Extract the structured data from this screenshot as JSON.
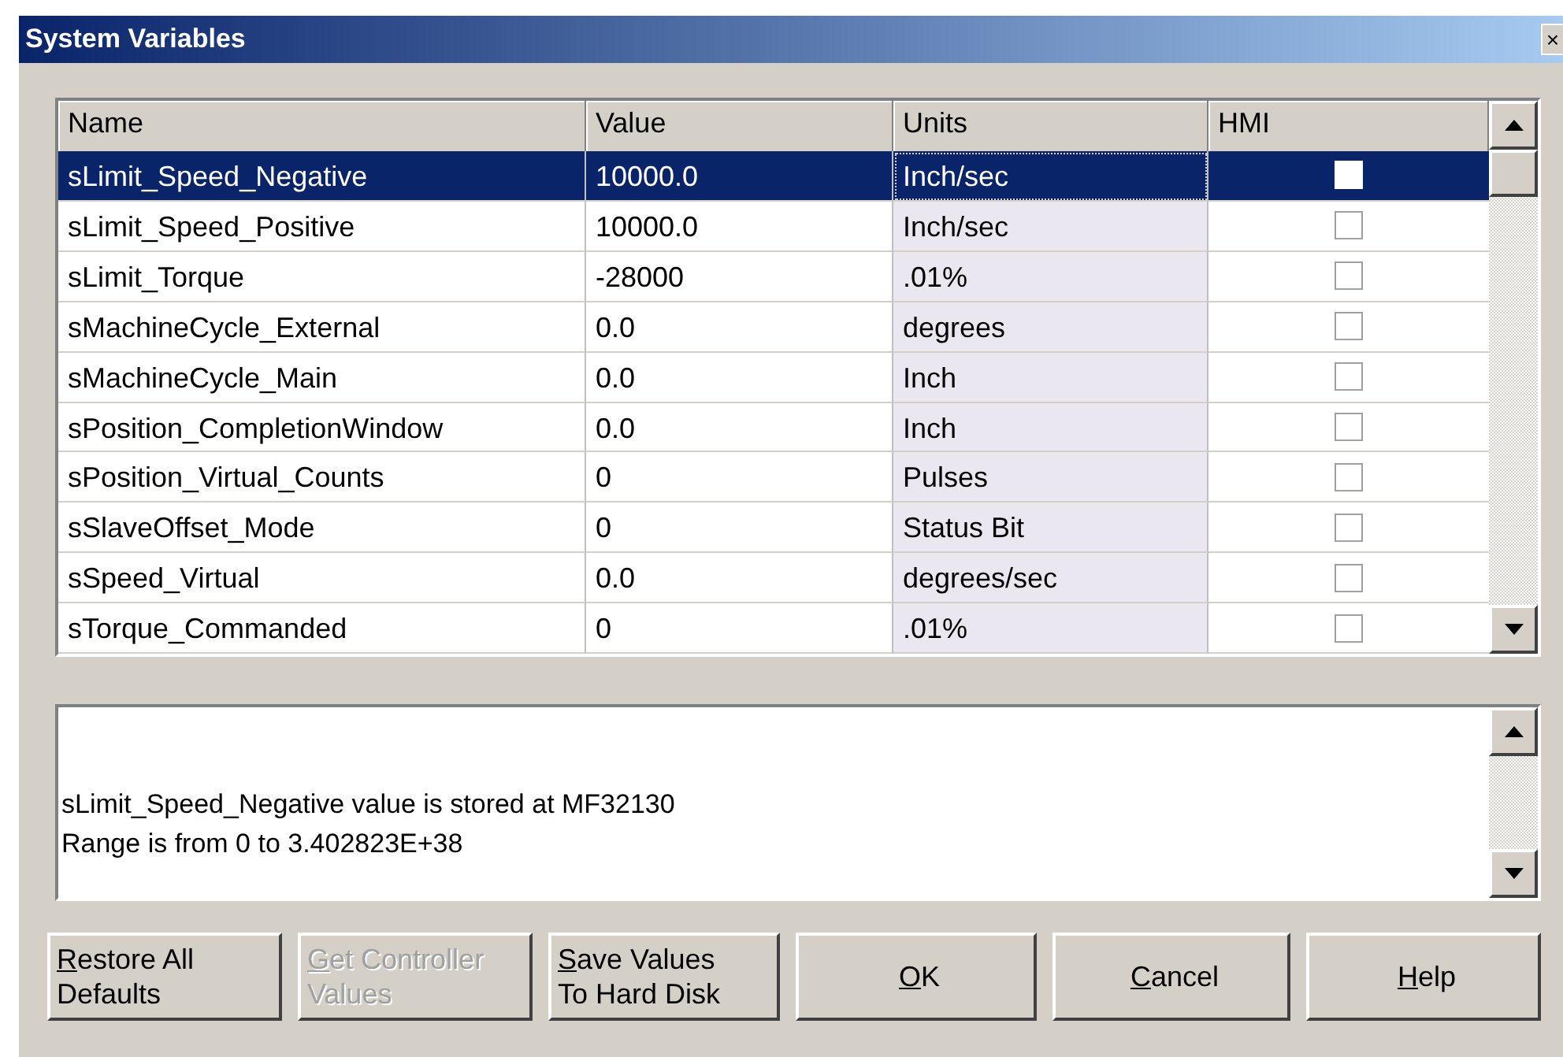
{
  "window": {
    "title": "System Variables",
    "close": "×"
  },
  "table": {
    "columns": [
      "Name",
      "Value",
      "Units",
      "HMI"
    ],
    "rows": [
      {
        "name": "sLimit_Speed_Negative",
        "value": "10000.0",
        "units": "Inch/sec",
        "hmi": false,
        "selected": true
      },
      {
        "name": "sLimit_Speed_Positive",
        "value": "10000.0",
        "units": "Inch/sec",
        "hmi": false,
        "selected": false
      },
      {
        "name": "sLimit_Torque",
        "value": "-28000",
        "units": ".01%",
        "hmi": false,
        "selected": false
      },
      {
        "name": "sMachineCycle_External",
        "value": "0.0",
        "units": "degrees",
        "hmi": false,
        "selected": false
      },
      {
        "name": "sMachineCycle_Main",
        "value": "0.0",
        "units": "Inch",
        "hmi": false,
        "selected": false
      },
      {
        "name": "sPosition_CompletionWindow",
        "value": "0.0",
        "units": "Inch",
        "hmi": false,
        "selected": false
      },
      {
        "name": "sPosition_Virtual_Counts",
        "value": "0",
        "units": "Pulses",
        "hmi": false,
        "selected": false
      },
      {
        "name": "sSlaveOffset_Mode",
        "value": "0",
        "units": "Status Bit",
        "hmi": false,
        "selected": false
      },
      {
        "name": "sSpeed_Virtual",
        "value": "0.0",
        "units": "degrees/sec",
        "hmi": false,
        "selected": false
      },
      {
        "name": "sTorque_Commanded",
        "value": "0",
        "units": ".01%",
        "hmi": false,
        "selected": false
      }
    ]
  },
  "description": [
    "sLimit_Speed_Negative value is stored at MF32130",
    "Range is from 0 to 3.402823E+38"
  ],
  "buttons": [
    {
      "lines": [
        "Restore All",
        "Defaults"
      ],
      "disabled": false
    },
    {
      "lines": [
        "Get Controller",
        "Values"
      ],
      "disabled": true
    },
    {
      "lines": [
        "Save Values",
        "To Hard Disk"
      ],
      "disabled": false
    },
    {
      "lines": [
        "OK"
      ],
      "disabled": false
    },
    {
      "lines": [
        "Cancel"
      ],
      "disabled": false
    },
    {
      "lines": [
        "Help"
      ],
      "disabled": false
    }
  ]
}
